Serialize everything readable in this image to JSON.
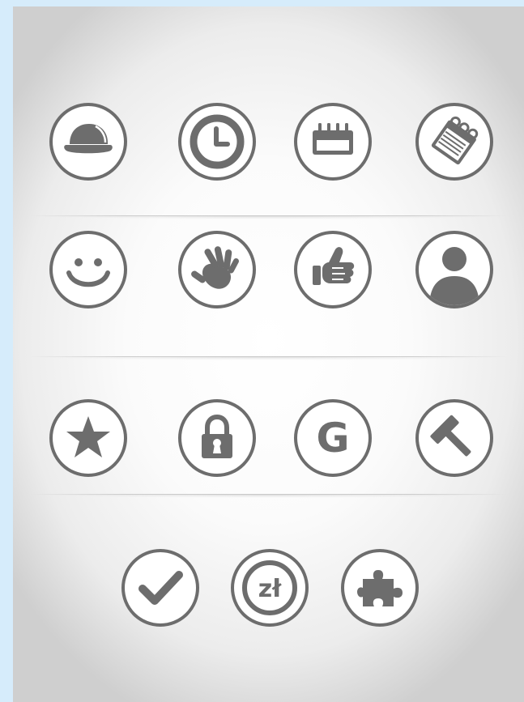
{
  "colors": {
    "icon": "#6d6d6d",
    "background": "#ffffff",
    "frame": "#d6ecfb"
  },
  "icons": [
    {
      "name": "helmet-icon"
    },
    {
      "name": "clock-icon"
    },
    {
      "name": "calendar-icon"
    },
    {
      "name": "notepad-icon"
    },
    {
      "name": "smiley-icon"
    },
    {
      "name": "hand-icon"
    },
    {
      "name": "thumbs-up-icon"
    },
    {
      "name": "user-icon"
    },
    {
      "name": "star-icon"
    },
    {
      "name": "lock-icon"
    },
    {
      "name": "g-icon",
      "text": "G"
    },
    {
      "name": "hammer-icon"
    },
    {
      "name": "checkmark-icon"
    },
    {
      "name": "zloty-icon",
      "text": "zł"
    },
    {
      "name": "puzzle-icon"
    }
  ]
}
